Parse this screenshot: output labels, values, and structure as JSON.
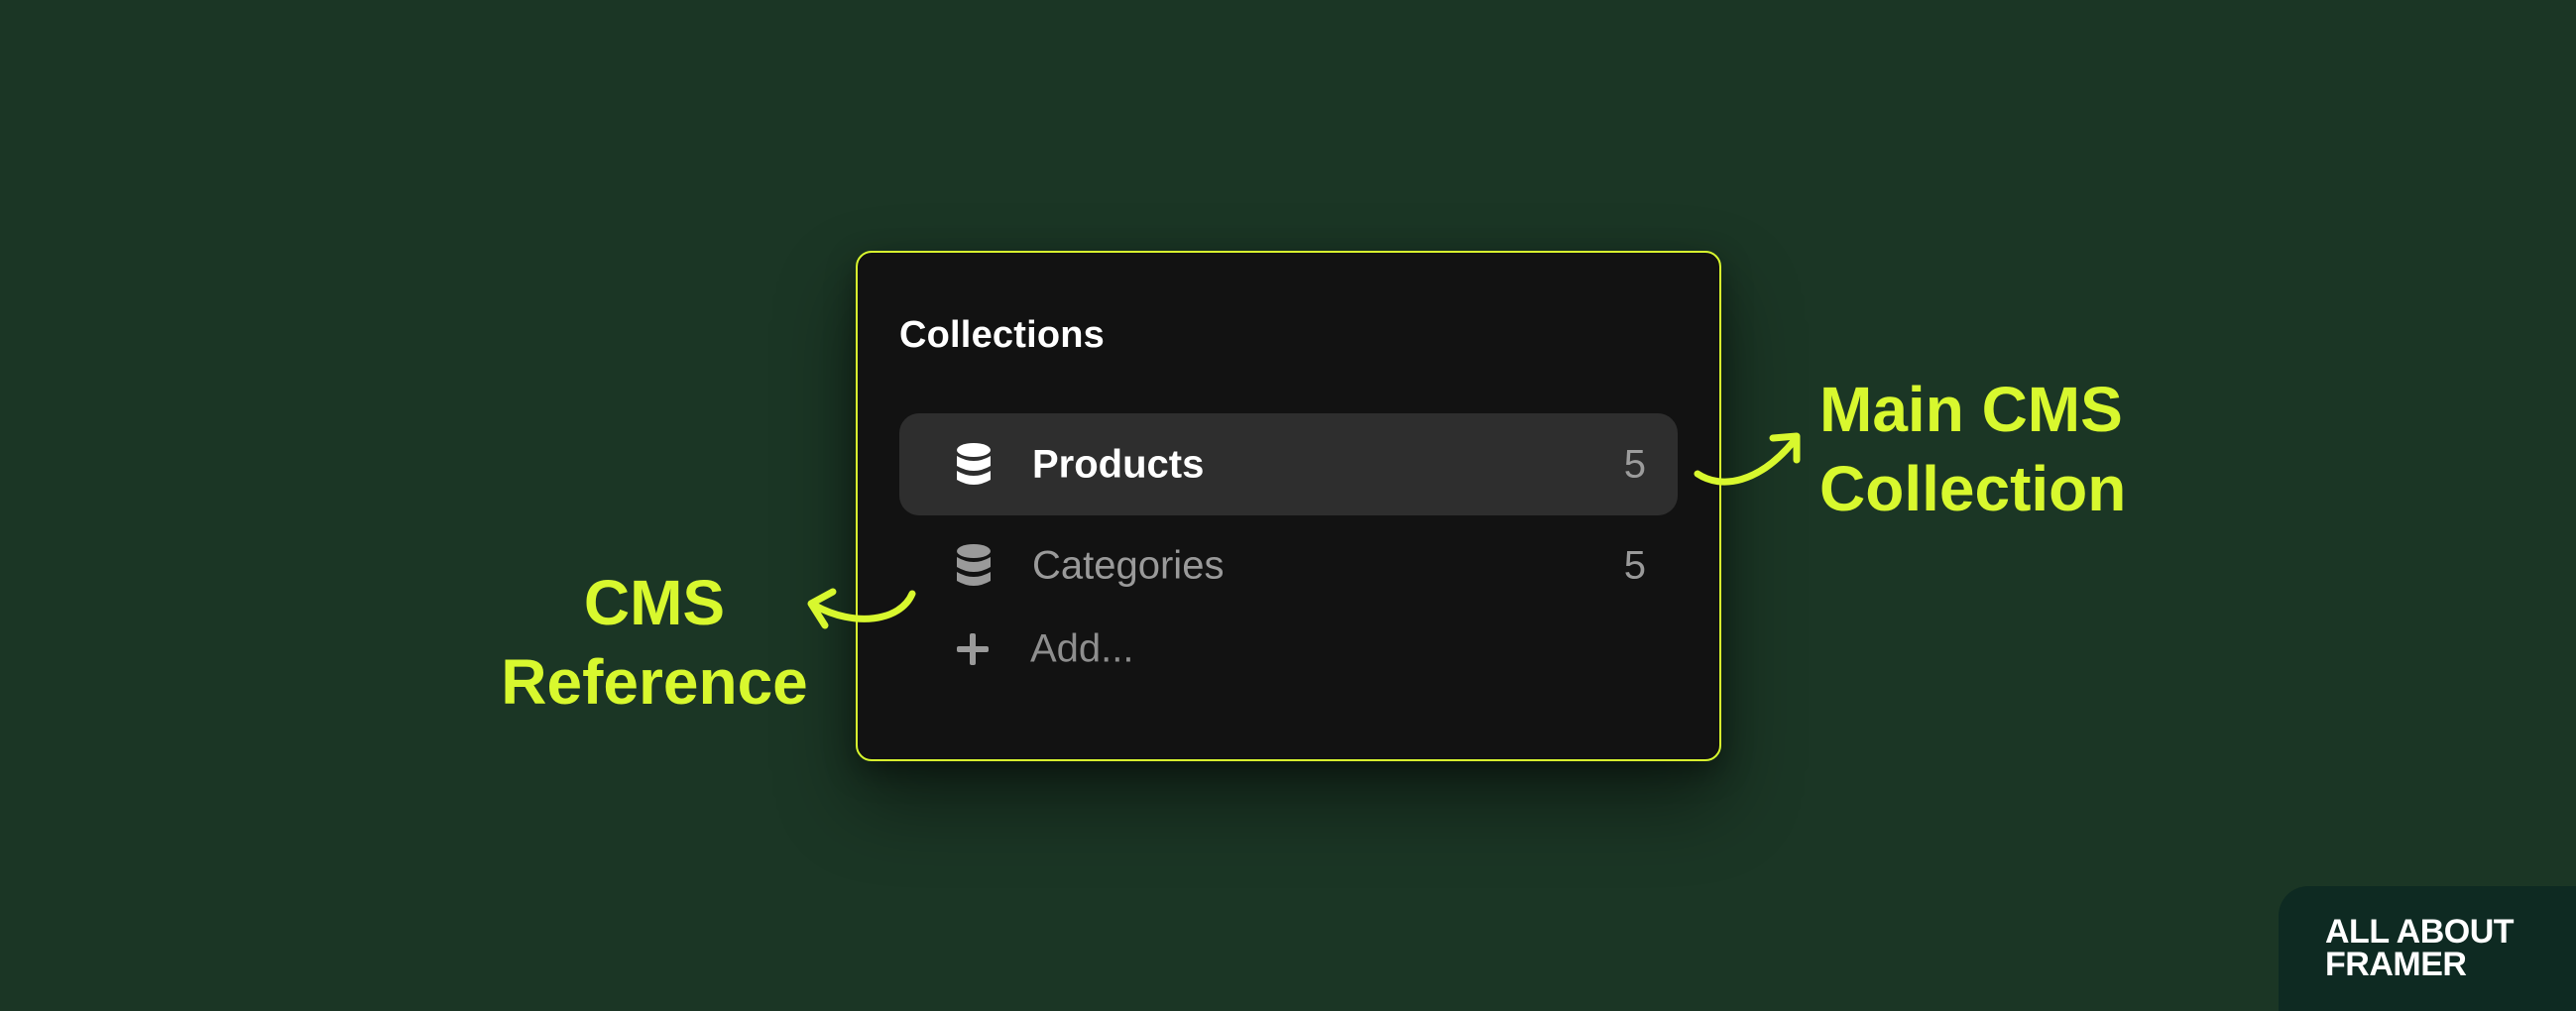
{
  "panel": {
    "title": "Collections",
    "collections": [
      {
        "label": "Products",
        "count": "5",
        "icon": "database-icon",
        "selected": true
      },
      {
        "label": "Categories",
        "count": "5",
        "icon": "database-icon",
        "selected": false
      }
    ],
    "add_label": "Add..."
  },
  "annotations": {
    "left_line1": "CMS",
    "left_line2": "Reference",
    "right_line1": "Main CMS",
    "right_line2": "Collection"
  },
  "brand": {
    "line1": "ALL ABOUT",
    "line2": "FRAMER"
  },
  "colors": {
    "background": "#1b3625",
    "accent": "#d8f82e",
    "panel": "#121212",
    "selected_row": "#2e2e2e",
    "brand_badge": "#0e2a22"
  }
}
